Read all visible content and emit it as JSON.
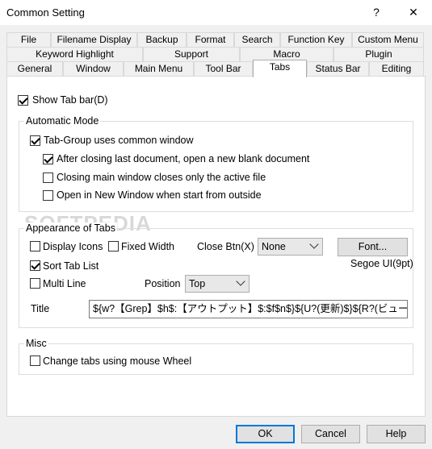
{
  "window": {
    "title": "Common Setting",
    "help_glyph": "?",
    "close_glyph": "✕"
  },
  "tabs": {
    "row1": [
      "File",
      "Filename Display",
      "Backup",
      "Format",
      "Search",
      "Function Key",
      "Custom Menu"
    ],
    "row2": [
      "Keyword Highlight",
      "Support",
      "Macro",
      "Plugin"
    ],
    "row3": [
      "General",
      "Window",
      "Main Menu",
      "Tool Bar",
      "Tabs",
      "Status Bar",
      "Editing"
    ],
    "active": "Tabs"
  },
  "show_tab_bar": {
    "label": "Show Tab bar(D)",
    "checked": true
  },
  "automatic_mode": {
    "title": "Automatic Mode",
    "tab_group": {
      "label": "Tab-Group uses common window",
      "checked": true
    },
    "after_closing": {
      "label": "After closing last document, open a new blank document",
      "checked": true
    },
    "closing_main": {
      "label": "Closing main window closes only the active file",
      "checked": false
    },
    "open_new_window": {
      "label": "Open in New Window when start from outside",
      "checked": false
    }
  },
  "appearance": {
    "title": "Appearance of Tabs",
    "display_icons": {
      "label": "Display Icons",
      "checked": false
    },
    "fixed_width": {
      "label": "Fixed Width",
      "checked": false
    },
    "close_btn_label": "Close Btn(X)",
    "close_btn_value": "None",
    "font_button": "Font...",
    "font_name": "Segoe UI(9pt)",
    "sort_tab_list": {
      "label": "Sort Tab List",
      "checked": true
    },
    "multi_line": {
      "label": "Multi Line",
      "checked": false
    },
    "position_label": "Position",
    "position_value": "Top",
    "title_label": "Title",
    "title_value": "${w?【Grep】$h$:【アウトプット】$:$f$n$}${U?(更新)$}${R?(ビューモード)$:(上書き禁止)$}"
  },
  "misc": {
    "title": "Misc",
    "mouse_wheel": {
      "label": "Change tabs using mouse Wheel",
      "checked": false
    }
  },
  "buttons": {
    "ok": "OK",
    "cancel": "Cancel",
    "help": "Help"
  },
  "watermark": "SOFTPEDIA",
  "colors": {
    "accent": "#0078d7",
    "panel": "#ffffff",
    "dialog": "#f0f0f0"
  }
}
